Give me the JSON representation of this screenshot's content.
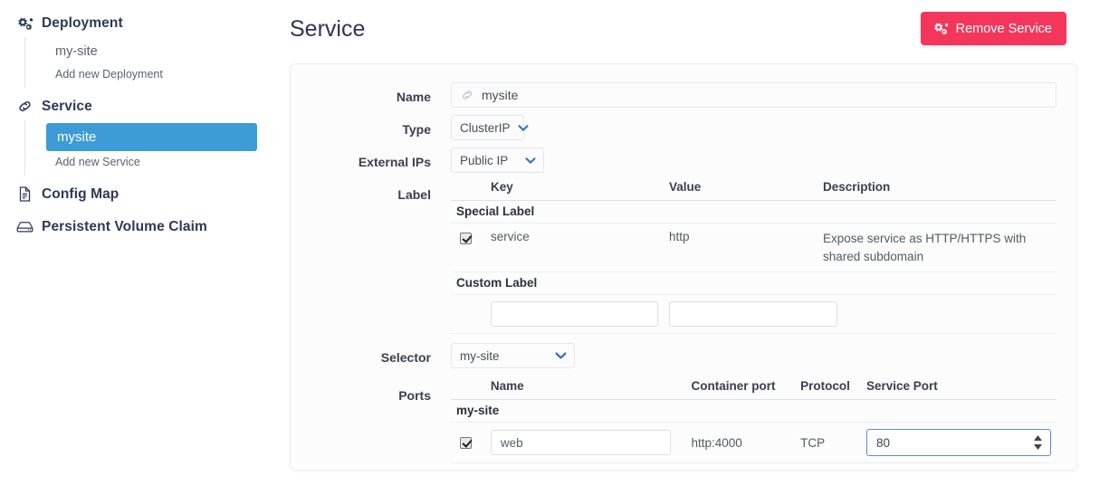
{
  "sidebar": {
    "groups": [
      {
        "id": "deployment",
        "label": "Deployment",
        "icon": "cogs-icon",
        "children": [
          {
            "label": "my-site",
            "active": false,
            "kind": "item"
          },
          {
            "label": "Add new Deployment",
            "active": false,
            "kind": "add"
          }
        ]
      },
      {
        "id": "service",
        "label": "Service",
        "icon": "link-icon",
        "children": [
          {
            "label": "mysite",
            "active": true,
            "kind": "item"
          },
          {
            "label": "Add new Service",
            "active": false,
            "kind": "add"
          }
        ]
      },
      {
        "id": "config-map",
        "label": "Config Map",
        "icon": "file-icon",
        "children": []
      },
      {
        "id": "persistent-volume-claim",
        "label": "Persistent Volume Claim",
        "icon": "hdd-icon",
        "children": []
      }
    ]
  },
  "header": {
    "title": "Service",
    "remove_button": "Remove Service",
    "remove_button_icon": "cogs-icon",
    "remove_button_color": "#f5365c"
  },
  "form": {
    "name": {
      "label": "Name",
      "value": "mysite",
      "icon": "link-icon"
    },
    "type": {
      "label": "Type",
      "value": "ClusterIP"
    },
    "external_ips": {
      "label": "External IPs",
      "value": "Public IP"
    },
    "label_section": {
      "label": "Label",
      "columns": [
        "Key",
        "Value",
        "Description"
      ],
      "special_label_heading": "Special Label",
      "special_rows": [
        {
          "checked": true,
          "key": "service",
          "value": "http",
          "description": "Expose service as HTTP/HTTPS with shared subdomain"
        }
      ],
      "custom_label_heading": "Custom Label",
      "custom_rows": [
        {
          "key": "",
          "value": "",
          "key_placeholder": "",
          "value_placeholder": ""
        }
      ]
    },
    "selector": {
      "label": "Selector",
      "value": "my-site"
    },
    "ports_section": {
      "label": "Ports",
      "columns": [
        "Name",
        "Container port",
        "Protocol",
        "Service Port"
      ],
      "group_heading": "my-site",
      "rows": [
        {
          "checked": true,
          "name": "web",
          "container_port": "http:4000",
          "protocol": "TCP",
          "service_port": "80"
        }
      ]
    }
  },
  "colors": {
    "active_nav": "#3d9bd8",
    "danger": "#f5365c",
    "focus_border": "#5a8dd6",
    "text": "#32325d"
  }
}
